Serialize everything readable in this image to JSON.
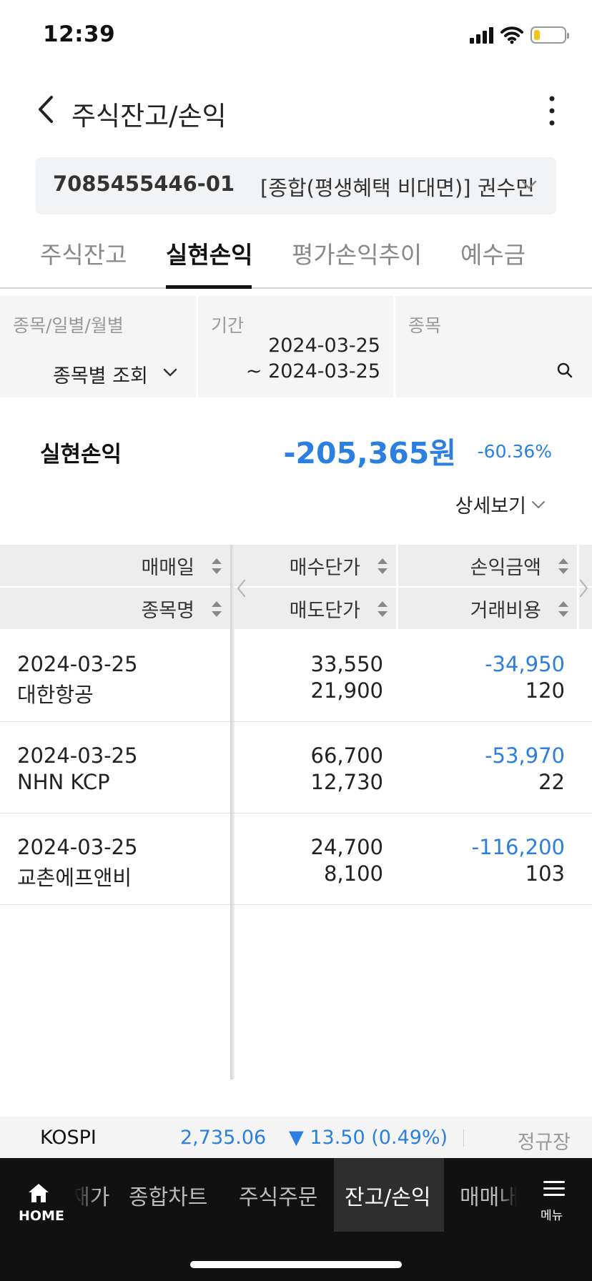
{
  "status": {
    "time": "12:39"
  },
  "header": {
    "title": "주식잔고/손익"
  },
  "account": {
    "number": "7085455446-01",
    "description": "[종합(평생혜택 비대면)] 권수민"
  },
  "tabs": [
    "주식잔고",
    "실현손익",
    "평가손익추이",
    "예수금"
  ],
  "filters": {
    "type_label": "종목/일별/월별",
    "type_value": "종목별 조회",
    "period_label": "기간",
    "period_start": "2024-03-25",
    "period_end": "~ 2024-03-25",
    "stock_label": "종목"
  },
  "summary": {
    "label": "실현손익",
    "amount": "-205,365원",
    "percent": "-60.36%",
    "detail": "상세보기"
  },
  "table": {
    "headers": {
      "trade_date": "매매일",
      "stock_name": "종목명",
      "buy_price": "매수단가",
      "sell_price": "매도단가",
      "profit": "손익금액",
      "fee": "거래비용"
    },
    "rows": [
      {
        "date": "2024-03-25",
        "name": "대한항공",
        "buy": "33,550",
        "sell": "21,900",
        "profit": "-34,950",
        "fee": "120"
      },
      {
        "date": "2024-03-25",
        "name": "NHN KCP",
        "buy": "66,700",
        "sell": "12,730",
        "profit": "-53,970",
        "fee": "22"
      },
      {
        "date": "2024-03-25",
        "name": "교촌에프앤비",
        "buy": "24,700",
        "sell": "8,100",
        "profit": "-116,200",
        "fee": "103"
      }
    ]
  },
  "market": {
    "name": "KOSPI",
    "index": "2,735.06",
    "change": "▼ 13.50 (0.49%)",
    "session": "정규장"
  },
  "bottom_nav": {
    "home": "HOME",
    "items": [
      "재가",
      "종합차트",
      "주식주문",
      "잔고/손익",
      "매매내"
    ],
    "menu": "메뉴"
  },
  "colors": {
    "negative": "#2a7fe0",
    "nav_bg": "#111111"
  }
}
